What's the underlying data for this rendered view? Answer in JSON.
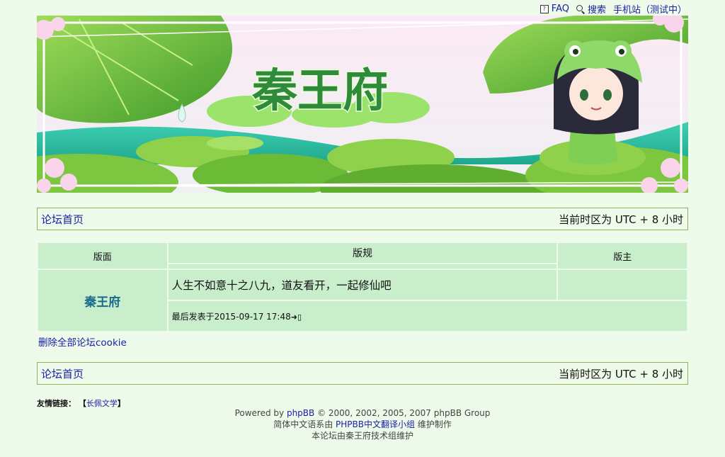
{
  "top_links": {
    "faq": "FAQ",
    "search": "搜索",
    "mobile": "手机站（测试中）"
  },
  "banner": {
    "title": "秦王府"
  },
  "nav": {
    "home": "论坛首页",
    "timezone": "当前时区为 UTC + 8 小时"
  },
  "table": {
    "col_forum": "版面",
    "col_rules": "版规",
    "col_moderator": "版主",
    "rows": [
      {
        "forum_name": "秦王府",
        "description": "人生不如意十之八九，道友看开，一起修仙吧",
        "last_post": "最后发表于2015-09-17 17:48",
        "moderator": ""
      }
    ]
  },
  "delete_cookies": "删除全部论坛cookie",
  "footer": {
    "links_label": "友情链接：",
    "link_open": "【",
    "link_text": "长佩文学",
    "link_close": "】",
    "powered_prefix": "Powered by ",
    "powered_link": "phpBB",
    "powered_suffix": " © 2000, 2002, 2005, 2007 phpBB Group",
    "translate_prefix": "简体中文语系由 ",
    "translate_link": "PHPBB中文翻译小组",
    "translate_suffix": " 维护制作",
    "maintained": "本论坛由秦王府技术组维护"
  },
  "colors": {
    "background": "#eefaea",
    "cell": "#c8eecb",
    "border": "#8fb35a",
    "link": "#1a20a8",
    "forum_title": "#1a6a8a"
  }
}
